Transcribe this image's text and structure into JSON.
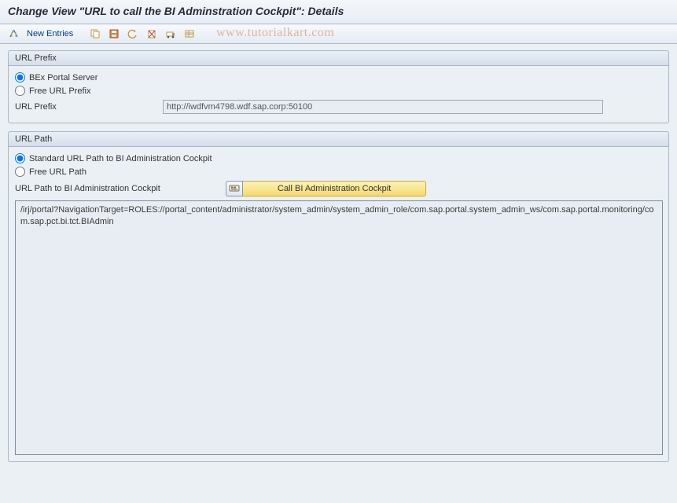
{
  "header": {
    "title": "Change View \"URL to call the BI Adminstration Cockpit\": Details"
  },
  "toolbar": {
    "new_entries_label": "New Entries"
  },
  "watermark": "www.tutorialkart.com",
  "group_prefix": {
    "title": "URL Prefix",
    "radio_bex": "BEx Portal Server",
    "radio_free": "Free URL Prefix",
    "field_label": "URL Prefix",
    "field_value": "http://iwdfvm4798.wdf.sap.corp:50100"
  },
  "group_path": {
    "title": "URL Path",
    "radio_std": "Standard URL Path to BI Administration Cockpit",
    "radio_free": "Free URL Path",
    "field_label": "URL Path to BI Administration Cockpit",
    "call_button": "Call BI Administration Cockpit",
    "path_value": "/irj/portal?NavigationTarget=ROLES://portal_content/administrator/system_admin/system_admin_role/com.sap.portal.system_admin_ws/com.sap.portal.monitoring/com.sap.pct.bi.tct.BIAdmin"
  }
}
